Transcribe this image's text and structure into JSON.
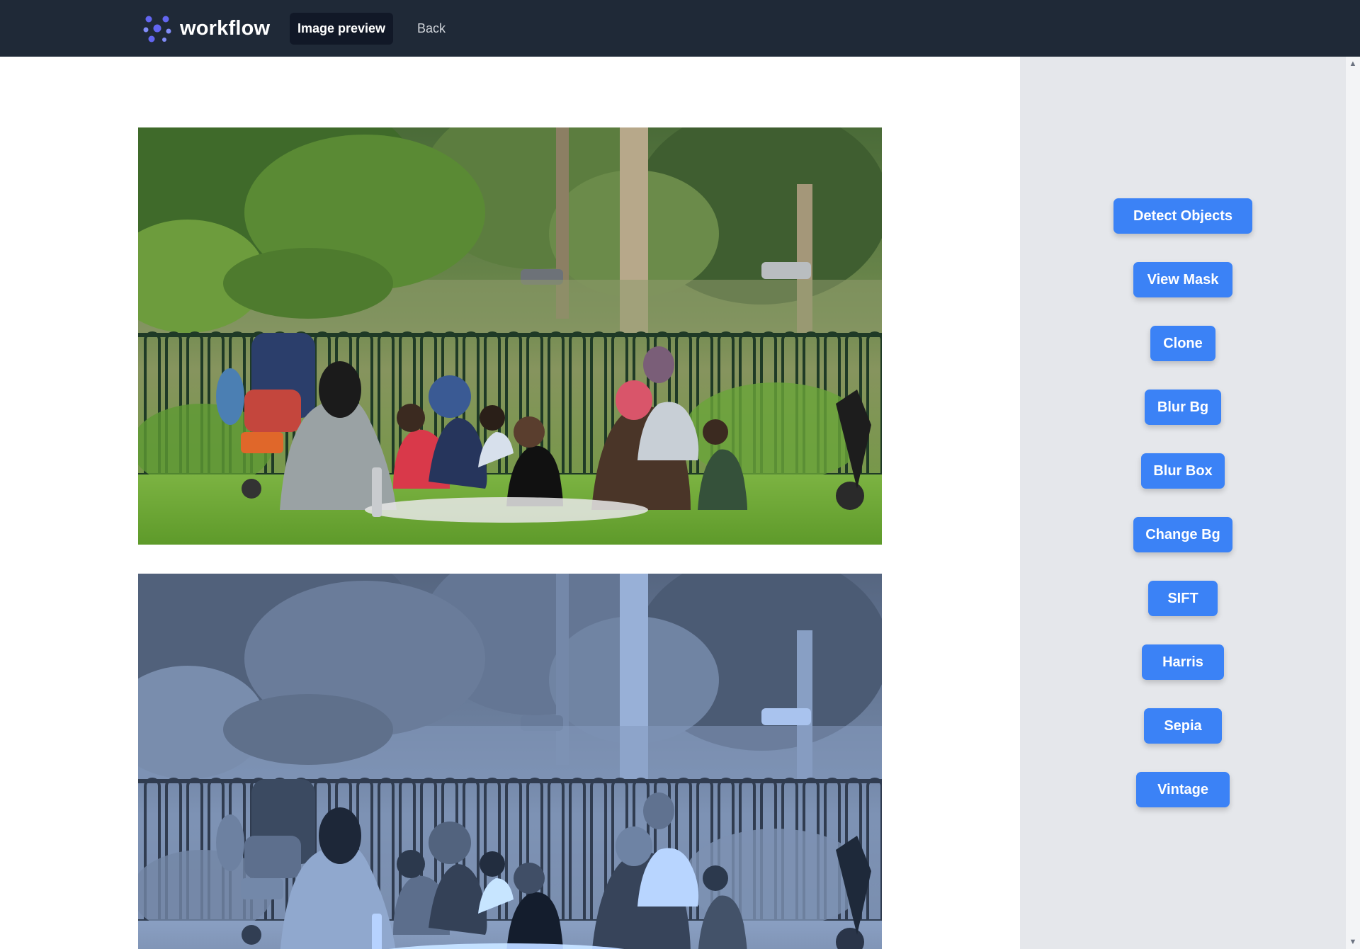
{
  "header": {
    "logo_text": "workflow",
    "nav_active": "Image preview",
    "nav_back": "Back",
    "colors": {
      "bar": "#1f2937",
      "active": "#111827",
      "logo_accent": "#6366f1"
    }
  },
  "images": {
    "original": {
      "label": "original-image",
      "style": "color"
    },
    "processed": {
      "label": "processed-image",
      "style": "cool-monochrome"
    }
  },
  "sidebar": {
    "buttons": [
      {
        "label": "Detect Objects",
        "name": "detect-objects-button"
      },
      {
        "label": "View Mask",
        "name": "view-mask-button"
      },
      {
        "label": "Clone",
        "name": "clone-button"
      },
      {
        "label": "Blur Bg",
        "name": "blur-bg-button"
      },
      {
        "label": "Blur Box",
        "name": "blur-box-button"
      },
      {
        "label": "Change Bg",
        "name": "change-bg-button"
      },
      {
        "label": "SIFT",
        "name": "sift-button"
      },
      {
        "label": "Harris",
        "name": "harris-button"
      },
      {
        "label": "Sepia",
        "name": "sepia-button"
      },
      {
        "label": "Vintage",
        "name": "vintage-button"
      }
    ],
    "button_color": "#3b82f6",
    "background": "#e5e7eb"
  },
  "scrollbar": {
    "up_icon": "chevron-up-icon",
    "down_icon": "chevron-down-icon"
  }
}
